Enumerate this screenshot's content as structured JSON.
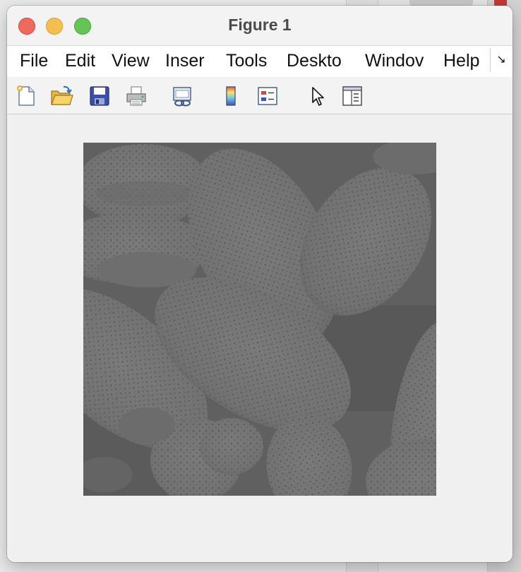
{
  "window": {
    "title": "Figure 1"
  },
  "menu": {
    "items": [
      "File",
      "Edit",
      "View",
      "Inser",
      "Tools",
      "Deskto",
      "Windov",
      "Help"
    ],
    "overflow_glyph": "↘"
  },
  "toolbar": {
    "buttons": [
      "new-figure-icon",
      "open-file-icon",
      "save-icon",
      "print-icon",
      "link-plot-icon",
      "insert-colorbar-icon",
      "insert-legend-icon",
      "edit-plot-pointer-icon",
      "property-inspector-icon"
    ]
  },
  "figure": {
    "content": "grayscale micrograph of pollen grains",
    "image_background": "#5f5f5f"
  },
  "colors": {
    "close": "#ee6a5e",
    "minimize": "#f5bf4f",
    "maximize": "#62c554",
    "figure_bg": "#f0f0f0"
  }
}
